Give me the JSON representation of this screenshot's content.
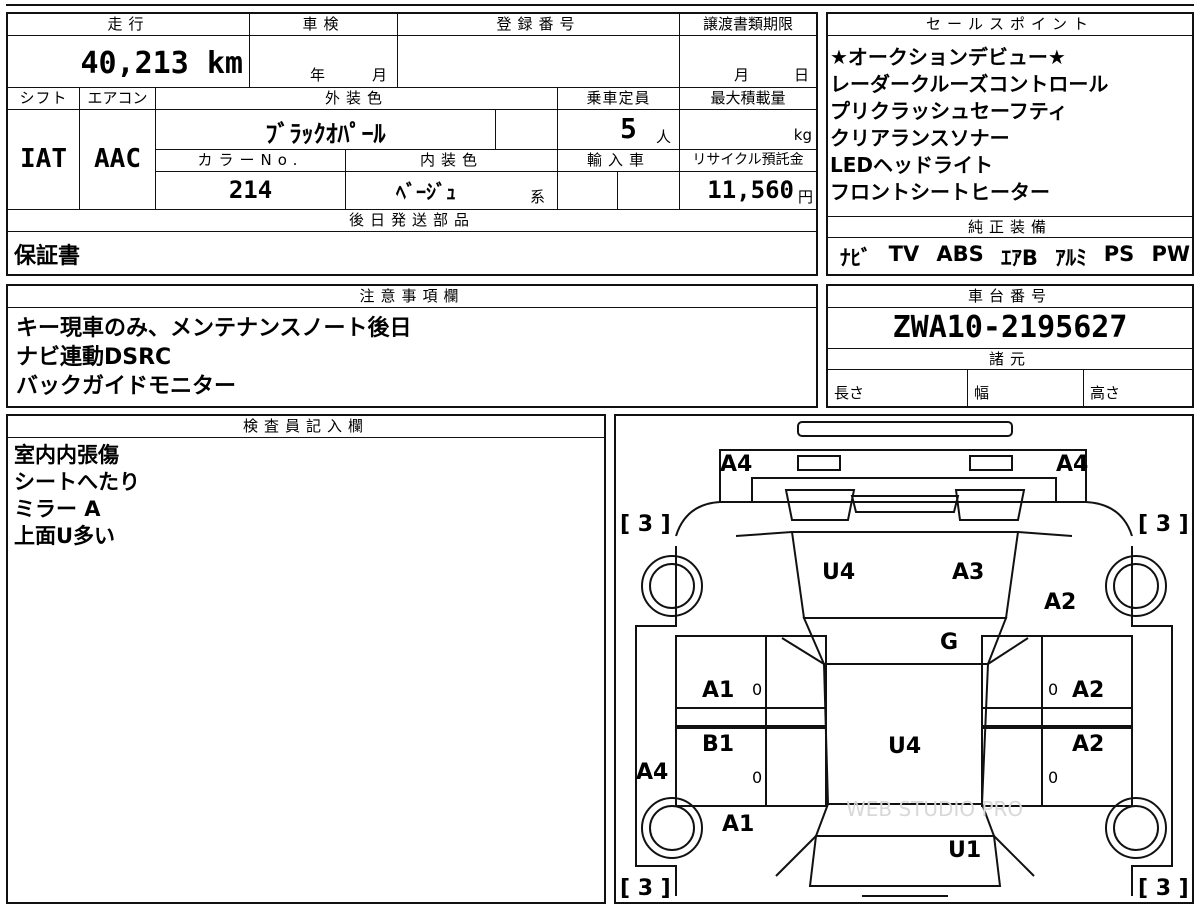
{
  "top_specs": {
    "mileage_header": "走行",
    "mileage_value": "40,213 km",
    "inspection_header": "車検",
    "inspection_year_label": "年",
    "inspection_month_label": "月",
    "registration_header": "登録番号",
    "transfer_deadline_header": "譲渡書類期限",
    "transfer_month_label": "月",
    "transfer_day_label": "日",
    "shift_header": "シフト",
    "shift_value": "IAT",
    "aircon_header": "エアコン",
    "aircon_value": "AAC",
    "exterior_color_header": "外装色",
    "exterior_color_value": "ﾌﾞﾗｯｸｵﾊﾟｰﾙ",
    "capacity_header": "乗車定員",
    "capacity_value": "5",
    "capacity_unit": "人",
    "max_load_header": "最大積載量",
    "max_load_unit": "kg",
    "color_no_header": "カラーNo.",
    "color_no_value": "214",
    "interior_color_header": "内装色",
    "interior_color_value": "ﾍﾞｰｼﾞｭ",
    "interior_color_suffix": "系",
    "import_header": "輸入車",
    "recycle_header": "リサイクル預託金",
    "recycle_value": "11,560",
    "recycle_unit": "円",
    "later_parts_header": "後日発送部品",
    "later_parts_value": "保証書"
  },
  "sales_points": {
    "header": "セールスポイント",
    "items": [
      "★オークションデビュー★",
      "レーダークルーズコントロール",
      "プリクラッシュセーフティ",
      "クリアランスソナー",
      "LEDヘッドライト",
      "フロントシートヒーター"
    ]
  },
  "genuine_equipment": {
    "header": "純正装備",
    "items": [
      "ﾅﾋﾞ",
      "TV",
      "ABS",
      "ｴｱB",
      "ｱﾙﾐ",
      "PS",
      "PW"
    ]
  },
  "notes": {
    "header": "注意事項欄",
    "lines": [
      "キー現車のみ、メンテナンスノート後日",
      "ナビ連動DSRC",
      "バックガイドモニター"
    ]
  },
  "chassis": {
    "header": "車台番号",
    "value": "ZWA10-2195627",
    "specs_header": "諸元",
    "length_label": "長さ",
    "width_label": "幅",
    "height_label": "高さ"
  },
  "inspector": {
    "header": "検査員記入欄",
    "lines": [
      "室内内張傷",
      "シートへたり",
      "ミラー A",
      "上面U多い"
    ]
  },
  "diagram": {
    "marks": {
      "front_left": "A4",
      "front_right": "A4",
      "tire_fl": "[ 3 ]",
      "tire_fr": "[ 3 ]",
      "tire_rl": "[ 3 ]",
      "tire_rr": "[ 3 ]",
      "hood_left": "U4",
      "hood_right": "A3",
      "fender_right": "A2",
      "windshield": "G",
      "front_door_left": "A1",
      "front_door_left_num": "0",
      "front_door_right": "A2",
      "front_door_right_num": "0",
      "rear_door_left": "B1",
      "rear_door_left_num": "0",
      "rear_door_right": "A2",
      "rear_door_right_num": "0",
      "roof": "U4",
      "side_left": "A4",
      "quarter_left": "A1",
      "trunk": "U1"
    },
    "watermark": "WEB STUDIO PRO"
  }
}
